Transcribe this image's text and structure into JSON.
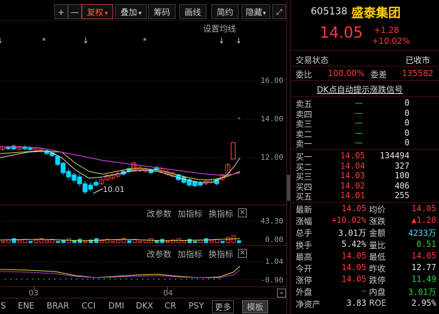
{
  "toolbar": {
    "plus": "+",
    "minus": "—",
    "fuquan": "复权",
    "diejia": "叠加",
    "chouma": "筹码",
    "huaxian": "画线",
    "jianyue": "简约",
    "yincang": "隐藏",
    "caret": "▾"
  },
  "main_chart": {
    "settings_label": "设置均线",
    "low_marker": "10.01",
    "y_ticks": [
      "16.00",
      "14.00",
      "12.00"
    ]
  },
  "panel1": {
    "change_params": "改参数",
    "add_indicator": "加指标",
    "switch_indicator": "换指标",
    "y_ticks": [
      "43.30",
      "0.00"
    ]
  },
  "panel2": {
    "change_params": "改参数",
    "add_indicator": "加指标",
    "switch_indicator": "换指标",
    "y_ticks": [
      "1.04",
      "-0.90"
    ]
  },
  "x_axis": {
    "labels": [
      "03",
      "04"
    ]
  },
  "bottom_tabs": [
    "S",
    "ENE",
    "BRAR",
    "CCI",
    "DMI",
    "DKX",
    "CR",
    "PSY",
    "更多",
    "模板"
  ],
  "colors": {
    "up": "#ff3b3b",
    "down": "#00d8ff",
    "ma_yellow": "#e8d84a",
    "ma_purple": "#c040d0",
    "ma_white": "#e0e0e0"
  },
  "quote": {
    "code": "605138",
    "name": "盛泰集团",
    "price": "14.05",
    "change": "+1.28",
    "change_pct": "+10.02%",
    "status_label": "交易状态",
    "status_value": "已收市",
    "weibi_label": "委比",
    "weibi_value": "100.00%",
    "weicha_label": "委差",
    "weicha_value": "135582",
    "signal_link": "DK点自动提示涨跌信号"
  },
  "sell_orders": [
    {
      "label": "卖五",
      "price": "—",
      "vol": "0"
    },
    {
      "label": "卖四",
      "price": "—",
      "vol": "0"
    },
    {
      "label": "卖三",
      "price": "—",
      "vol": "0"
    },
    {
      "label": "卖二",
      "price": "—",
      "vol": "0"
    },
    {
      "label": "卖一",
      "price": "—",
      "vol": "0"
    }
  ],
  "buy_orders": [
    {
      "label": "买一",
      "price": "14.05",
      "vol": "134494"
    },
    {
      "label": "买二",
      "price": "14.04",
      "vol": "327"
    },
    {
      "label": "买三",
      "price": "14.03",
      "vol": "100"
    },
    {
      "label": "买四",
      "price": "14.02",
      "vol": "406"
    },
    {
      "label": "买五",
      "price": "14.01",
      "vol": "255"
    }
  ],
  "stats": [
    {
      "l1": "最新",
      "v1": "14.05",
      "c1": "red",
      "l2": "均价",
      "v2": "14.05",
      "c2": "red"
    },
    {
      "l1": "涨幅",
      "v1": "+10.02%",
      "c1": "red",
      "l2": "涨跌",
      "v2": "▲1.28",
      "c2": "red"
    },
    {
      "l1": "总手",
      "v1": "3.01万",
      "c1": "white",
      "l2": "金额",
      "v2": "4233万",
      "c2": "cyan"
    },
    {
      "l1": "换手",
      "v1": "5.42%",
      "c1": "white",
      "l2": "量比",
      "v2": "0.51",
      "c2": "green"
    },
    {
      "l1": "最高",
      "v1": "14.05",
      "c1": "red",
      "l2": "最低",
      "v2": "14.05",
      "c2": "red"
    },
    {
      "l1": "今开",
      "v1": "14.05",
      "c1": "red",
      "l2": "昨收",
      "v2": "12.77",
      "c2": "white"
    },
    {
      "l1": "涨停",
      "v1": "14.05",
      "c1": "red",
      "l2": "跌停",
      "v2": "11.49",
      "c2": "green"
    },
    {
      "l1": "外盘",
      "v1": "—",
      "c1": "red",
      "l2": "内盘",
      "v2": "3.01万",
      "c2": "green"
    },
    {
      "l1": "净资产",
      "v1": "3.83",
      "c1": "white",
      "l2": "ROE",
      "v2": "2.95%",
      "c2": "white"
    }
  ]
}
